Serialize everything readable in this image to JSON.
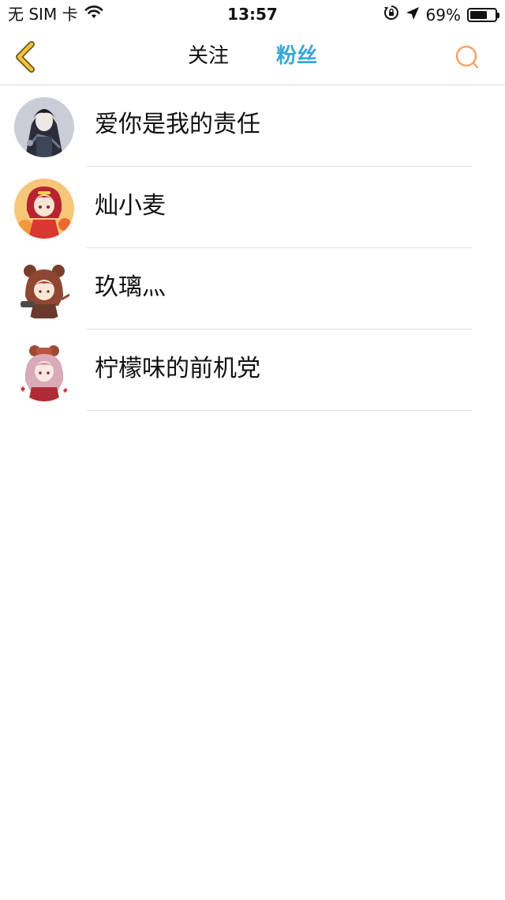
{
  "status_bar": {
    "carrier": "无 SIM 卡",
    "time": "13:57",
    "battery_percent": "69%",
    "battery_level": 0.69,
    "icons": [
      "wifi-icon",
      "rotation-lock-icon",
      "location-arrow-icon",
      "battery-icon"
    ]
  },
  "nav": {
    "tabs": [
      {
        "label": "关注",
        "active": false
      },
      {
        "label": "粉丝",
        "active": true
      }
    ],
    "active_color": "#37a6d6",
    "back_icon": "chevron-left-icon",
    "back_icon_color": "#f0c33c",
    "search_icon": "search-icon",
    "search_icon_color": "#f4a46a"
  },
  "fans": [
    {
      "nickname": "爱你是我的责任",
      "avatar": "avatar-dark-gothic-character"
    },
    {
      "nickname": "灿小麦",
      "avatar": "avatar-red-hair-character"
    },
    {
      "nickname": "玖璃灬",
      "avatar": "avatar-bear-hood-character"
    },
    {
      "nickname": "柠檬味的前机党",
      "avatar": "avatar-bear-ears-pink-character"
    }
  ]
}
